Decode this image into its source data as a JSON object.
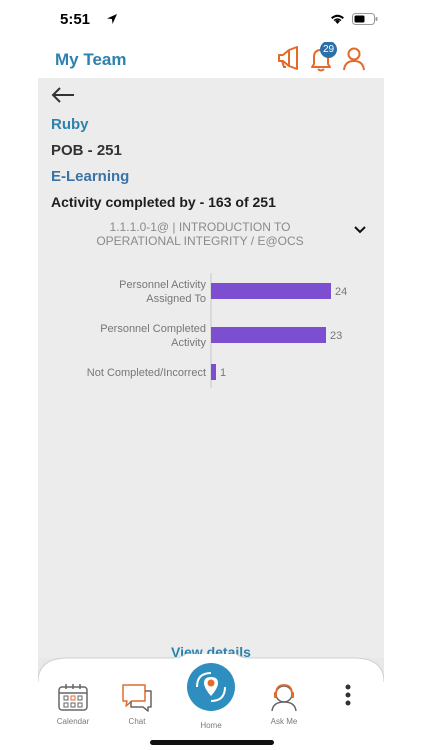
{
  "status": {
    "time": "5:51"
  },
  "header": {
    "title": "My Team",
    "notification_count": "29"
  },
  "detail": {
    "name": "Ruby",
    "pob": "POB - 251",
    "category": "E-Learning",
    "activity_summary": "Activity completed by - 163 of 251",
    "course_line1": "1.1.1.0-1@ | INTRODUCTION TO",
    "course_line2": "OPERATIONAL INTEGRITY / E@OCS",
    "view_details": "View details"
  },
  "chart_data": {
    "type": "bar",
    "orientation": "horizontal",
    "categories": [
      "Personnel Activity Assigned To",
      "Personnel Completed Activity",
      "Not Completed/Incorrect"
    ],
    "category_lines": [
      [
        "Personnel Activity",
        "Assigned To"
      ],
      [
        "Personnel Completed",
        "Activity"
      ],
      [
        "Not Completed/Incorrect"
      ]
    ],
    "values": [
      24,
      23,
      1
    ],
    "value_labels": [
      "24",
      "23",
      "1"
    ],
    "xlim": [
      0,
      25
    ],
    "bar_color": "#7b4fd0"
  },
  "tabs": [
    {
      "label": "Calendar",
      "icon": "calendar-icon"
    },
    {
      "label": "Chat",
      "icon": "chat-icon"
    },
    {
      "label": "Home",
      "icon": "home-icon"
    },
    {
      "label": "Ask Me",
      "icon": "ask-me-icon"
    }
  ],
  "colors": {
    "accent": "#2d82ad",
    "orange": "#e46a2a",
    "bar": "#7b4fd0"
  }
}
